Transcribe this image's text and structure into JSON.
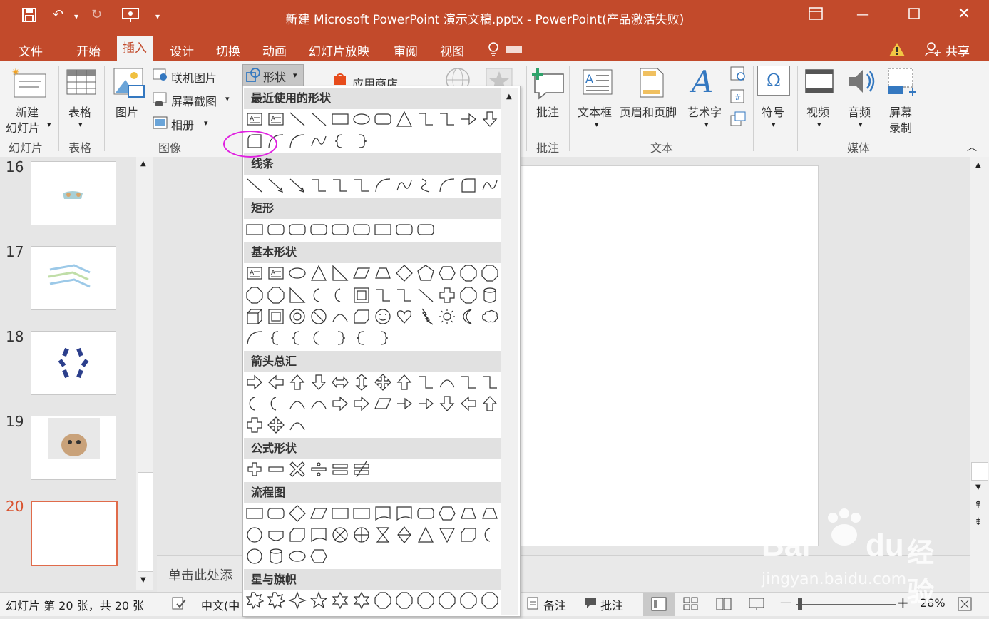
{
  "window": {
    "title": "新建 Microsoft PowerPoint 演示文稿.pptx - PowerPoint(产品激活失败)",
    "share_label": "共享",
    "share_icon": "person-plus-icon",
    "warning_icon": "warning-icon",
    "accent": "#c24a2b"
  },
  "tabs": [
    "文件",
    "开始",
    "插入",
    "设计",
    "切换",
    "动画",
    "幻灯片放映",
    "审阅",
    "视图"
  ],
  "active_tab": "插入",
  "ribbon": {
    "new_slide": "新建\n幻灯片",
    "new_slide_line1": "新建",
    "new_slide_line2": "幻灯片",
    "table": "表格",
    "picture": "图片",
    "online_pictures": "联机图片",
    "screenshot": "屏幕截图",
    "album": "相册",
    "shapes": "形状",
    "store": "应用商店",
    "comment": "批注",
    "textbox": "文本框",
    "header_footer": "页眉和页脚",
    "wordart": "艺术字",
    "symbol": "符号",
    "video": "视频",
    "audio": "音频",
    "screen_record_line1": "屏幕",
    "screen_record_line2": "录制",
    "groups": {
      "slides": "幻灯片",
      "tables": "表格",
      "images": "图像",
      "comments": "批注",
      "text": "文本",
      "media": "媒体"
    }
  },
  "shapes_gallery": {
    "sections": [
      "最近使用的形状",
      "线条",
      "矩形",
      "基本形状",
      "箭头总汇",
      "公式形状",
      "流程图",
      "星与旗帜"
    ],
    "highlight_color": "#e020e0"
  },
  "thumbnails": [
    {
      "number": "16"
    },
    {
      "number": "17"
    },
    {
      "number": "18"
    },
    {
      "number": "19"
    },
    {
      "number": "20"
    }
  ],
  "notes_placeholder": "单击此处添",
  "status": {
    "slide_info": "幻灯片 第 20 张，共 20 张",
    "language": "中文(中",
    "notes": "备注",
    "comments": "批注",
    "zoom": "28%",
    "minus": "—",
    "plus": "+"
  },
  "watermark": {
    "brand_latin": "Bai",
    "brand_du": "du",
    "brand_cn": "经验",
    "url": "jingyan.baidu.com"
  }
}
